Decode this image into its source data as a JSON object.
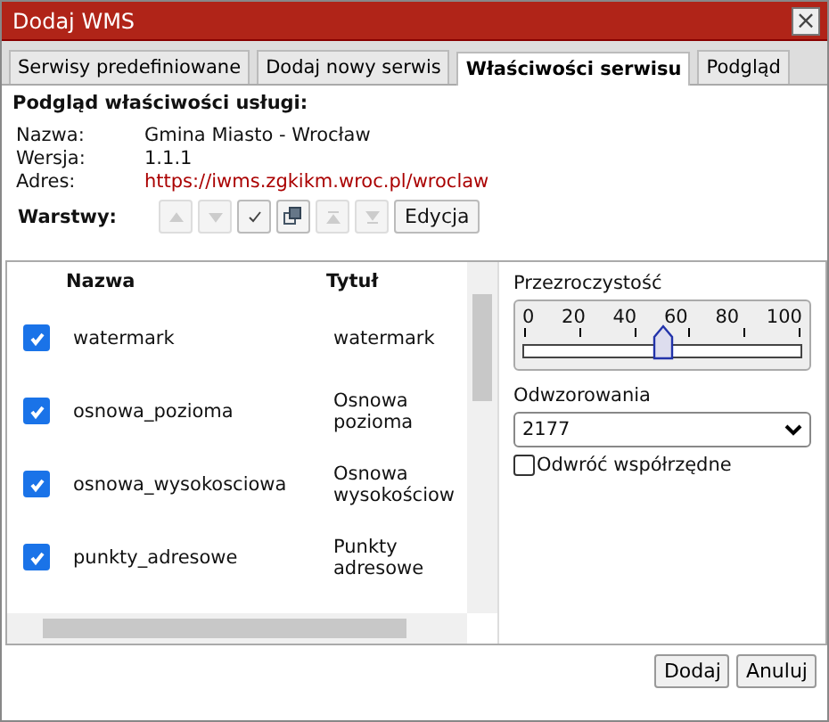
{
  "window": {
    "title": "Dodaj WMS",
    "close": "×"
  },
  "tabs": [
    {
      "label": "Serwisy predefiniowane",
      "selected": false
    },
    {
      "label": "Dodaj nowy serwis",
      "selected": false
    },
    {
      "label": "Właściwości serwisu",
      "selected": true
    },
    {
      "label": "Podgląd",
      "selected": false
    }
  ],
  "heading": "Podgląd właściwości usługi:",
  "properties": [
    {
      "label": "Nazwa:",
      "value": "Gmina Miasto - Wrocław",
      "kind": "text"
    },
    {
      "label": "Wersja:",
      "value": "1.1.1",
      "kind": "text"
    },
    {
      "label": "Adres:",
      "value": "https://iwms.zgkikm.wroc.pl/wroclaw",
      "kind": "link"
    }
  ],
  "layers_label": "Warstwy:",
  "toolbar": [
    {
      "kind": "up",
      "disabled": true
    },
    {
      "kind": "down",
      "disabled": true
    },
    {
      "kind": "check",
      "disabled": false
    },
    {
      "kind": "copy",
      "disabled": false
    },
    {
      "kind": "top",
      "disabled": true
    },
    {
      "kind": "bottom",
      "disabled": true
    },
    {
      "kind": "text",
      "label": "Edycja",
      "disabled": false
    }
  ],
  "table": {
    "columns": [
      "Nazwa",
      "Tytuł"
    ],
    "rows": [
      {
        "checked": true,
        "name": "watermark",
        "title": "watermark"
      },
      {
        "checked": true,
        "name": "osnowa_pozioma",
        "title": "Osnowa pozioma"
      },
      {
        "checked": true,
        "name": "osnowa_wysokosciowa",
        "title": "Osnowa wysokościow"
      },
      {
        "checked": true,
        "name": "punkty_adresowe",
        "title": "Punkty adresowe"
      }
    ]
  },
  "opacity": {
    "label": "Przezroczystość",
    "ticks": [
      "0",
      "20",
      "40",
      "60",
      "80",
      "100"
    ],
    "level": 0.5
  },
  "projection": {
    "label": "Odwzorowania",
    "value": "2177"
  },
  "invert": {
    "label": "Odwróć współrzędne",
    "checked": false
  },
  "buttons": [
    "Dodaj",
    "Anuluj"
  ]
}
